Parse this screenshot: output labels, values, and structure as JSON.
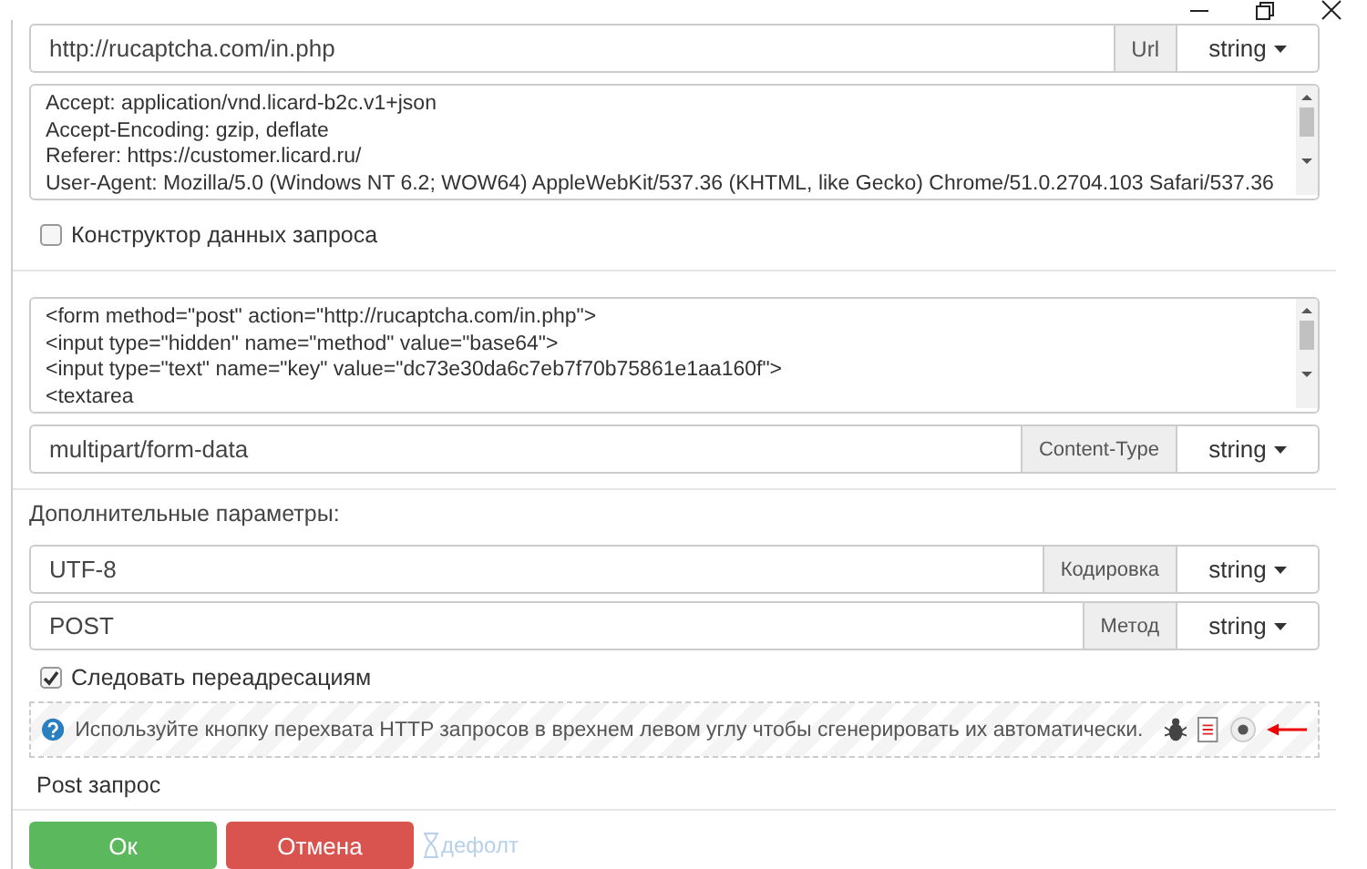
{
  "url": {
    "value": "http://rucaptcha.com/in.php",
    "addon": "Url",
    "type": "string"
  },
  "headers": {
    "lines": [
      "Accept: application/vnd.licard-b2c.v1+json",
      "Accept-Encoding: gzip, deflate",
      "Referer: https://customer.licard.ru/",
      "User-Agent: Mozilla/5.0 (Windows NT 6.2; WOW64) AppleWebKit/537.36 (KHTML, like Gecko) Chrome/51.0.2704.103 Safari/537.36"
    ]
  },
  "constructor": {
    "label": "Конструктор данных запроса",
    "checked": false
  },
  "body": {
    "lines": [
      "<form method=\"post\" action=\"http://rucaptcha.com/in.php\">",
      "<input type=\"hidden\" name=\"method\" value=\"base64\">",
      "<input type=\"text\" name=\"key\" value=\"dc73e30da6c7eb7f70b75861e1aa160f\">",
      "<textarea"
    ]
  },
  "content_type": {
    "value": "multipart/form-data",
    "addon": "Content-Type",
    "type": "string"
  },
  "extra_params": {
    "title": "Дополнительные параметры:",
    "fields": [
      {
        "value": "UTF-8",
        "addon": "Кодировка",
        "type": "string"
      },
      {
        "value": "POST",
        "addon": "Метод",
        "type": "string"
      }
    ]
  },
  "follow_redirects": {
    "label": "Следовать переадресациям",
    "checked": true
  },
  "hint": {
    "text": "Используйте кнопку перехвата HTTP запросов в врехнем левом углу чтобы сгенерировать их автоматически."
  },
  "request_name": "Post запрос",
  "buttons": [
    {
      "label": "Ок",
      "kind": "primary"
    },
    {
      "label": "Отмена",
      "kind": "danger"
    }
  ],
  "default_link": {
    "label": "дефолт",
    "disabled": true
  }
}
